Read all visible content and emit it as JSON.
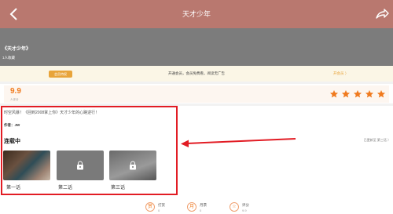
{
  "header": {
    "title": "天才少年",
    "back_icon": "chevron-left-icon",
    "share_icon": "share-icon"
  },
  "hero": {
    "name": "《天才少年》",
    "favorites": "1人收藏"
  },
  "vip": {
    "tag": "会员特权",
    "desc": "开通会员，会员免费看，阅读无广告",
    "open_label": "开会员 〉"
  },
  "rating": {
    "score": "9.9",
    "label": "人评分",
    "stars": 5,
    "accent": "#f07a1e"
  },
  "summary": {
    "intro": "时空风暴！《回到2008掌上你》天才少年的心路逆行！",
    "author": "作者：JW",
    "serial_status": "连载中",
    "updated": "已更新至 第三话 〉"
  },
  "episodes": [
    {
      "label": "第一话",
      "locked": false
    },
    {
      "label": "第二话",
      "locked": true
    },
    {
      "label": "第三话",
      "locked": true
    }
  ],
  "footer": [
    {
      "icon": "赏",
      "label": "打赏",
      "value": "0"
    },
    {
      "icon": "月",
      "label": "月票",
      "value": "0"
    },
    {
      "icon": "☆",
      "label": "评分",
      "value": "9.9"
    }
  ],
  "annotation": {
    "highlight_color": "#e21c24"
  }
}
